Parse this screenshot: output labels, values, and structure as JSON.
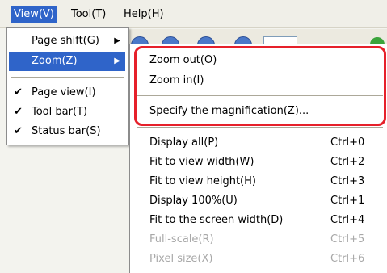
{
  "menubar": {
    "items": [
      {
        "label": "View(V)"
      },
      {
        "label": "Tool(T)"
      },
      {
        "label": "Help(H)"
      }
    ]
  },
  "view_menu": {
    "items": [
      {
        "label": "Page shift(G)",
        "submenu": true
      },
      {
        "label": "Zoom(Z)",
        "submenu": true,
        "highlighted": true
      },
      {
        "label": "Page view(I)",
        "checked": true
      },
      {
        "label": "Tool bar(T)",
        "checked": true
      },
      {
        "label": "Status bar(S)",
        "checked": true
      }
    ]
  },
  "zoom_menu": {
    "items": [
      {
        "label": "Zoom out(O)"
      },
      {
        "label": "Zoom in(I)"
      },
      {
        "label": "Specify the magnification(Z)..."
      },
      {
        "label": "Display all(P)",
        "shortcut": "Ctrl+0"
      },
      {
        "label": "Fit to view width(W)",
        "shortcut": "Ctrl+2"
      },
      {
        "label": "Fit to view height(H)",
        "shortcut": "Ctrl+3"
      },
      {
        "label": "Display 100%(U)",
        "shortcut": "Ctrl+1"
      },
      {
        "label": "Fit to the screen width(D)",
        "shortcut": "Ctrl+4"
      },
      {
        "label": "Full-scale(R)",
        "shortcut": "Ctrl+5",
        "disabled": true
      },
      {
        "label": "Pixel size(X)",
        "shortcut": "Ctrl+6",
        "disabled": true
      }
    ]
  },
  "icons": {
    "check": "✔",
    "submenu_arrow": "▶"
  },
  "colors": {
    "highlight": "#2f64c9",
    "annotation": "#e6202a"
  }
}
